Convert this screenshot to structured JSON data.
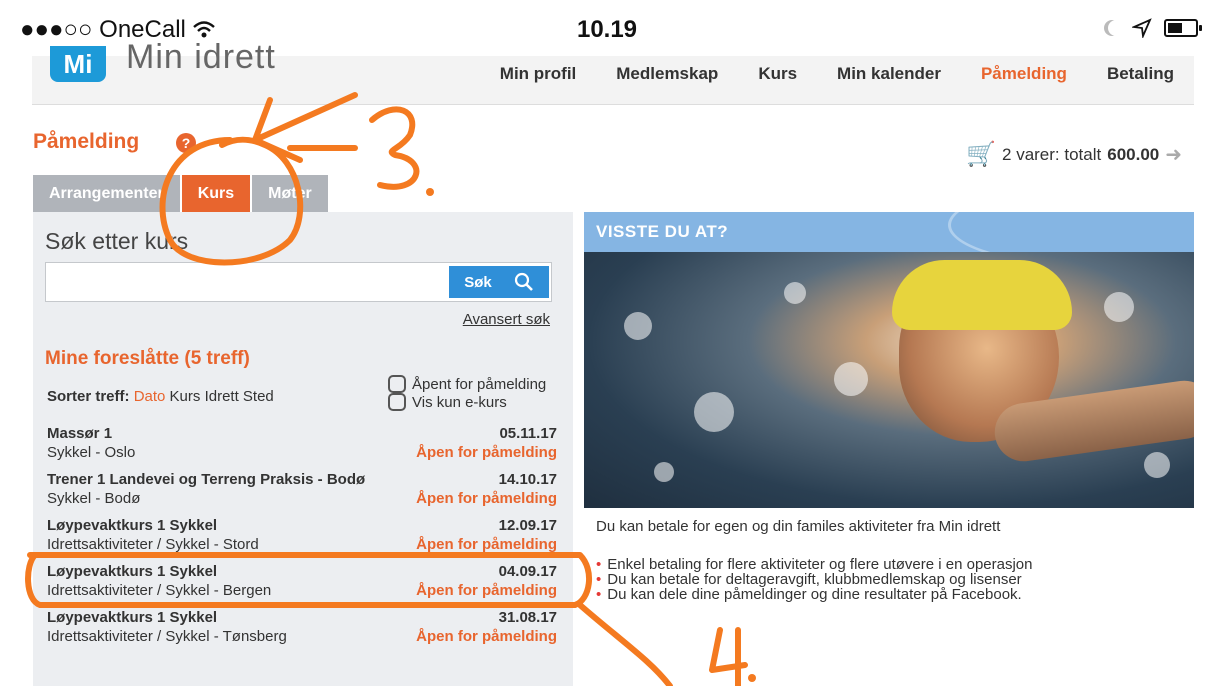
{
  "status_bar": {
    "signal": "●●●○○",
    "carrier": "OneCall",
    "wifi_icon": "wifi-icon",
    "time": "10.19"
  },
  "header": {
    "logo_mark": "Mi",
    "logo_text": "Min idrett",
    "nav": [
      {
        "label": "Min profil",
        "active": false
      },
      {
        "label": "Medlemskap",
        "active": false
      },
      {
        "label": "Kurs",
        "active": false
      },
      {
        "label": "Min kalender",
        "active": false
      },
      {
        "label": "Påmelding",
        "active": true
      },
      {
        "label": "Betaling",
        "active": false
      }
    ]
  },
  "page": {
    "title": "Påmelding",
    "help": "?"
  },
  "cart": {
    "items_text": "2 varer: totalt",
    "total": "600.00"
  },
  "tabs": [
    {
      "label": "Arrangementer",
      "active": false
    },
    {
      "label": "Kurs",
      "active": true
    },
    {
      "label": "Møter",
      "active": false
    }
  ],
  "search": {
    "label": "Søk etter kurs",
    "placeholder": "",
    "button": "Søk",
    "advanced": "Avansert søk"
  },
  "suggestions": {
    "title": "Mine foreslåtte (5 treff)",
    "sort_label": "Sorter treff:",
    "sort_options": [
      "Dato",
      "Kurs",
      "Idrett",
      "Sted"
    ],
    "sort_active": "Dato",
    "filters": [
      "Åpent for påmelding",
      "Vis kun e-kurs"
    ],
    "results": [
      {
        "title": "Massør 1",
        "subtitle": "Sykkel - Oslo",
        "date": "05.11.17",
        "status": "Åpen for påmelding"
      },
      {
        "title": "Trener 1 Landevei og Terreng Praksis - Bodø",
        "subtitle": "Sykkel - Bodø",
        "date": "14.10.17",
        "status": "Åpen for påmelding"
      },
      {
        "title": "Løypevaktkurs 1 Sykkel",
        "subtitle": "Idrettsaktiviteter / Sykkel - Stord",
        "date": "12.09.17",
        "status": "Åpen for påmelding"
      },
      {
        "title": "Løypevaktkurs 1 Sykkel",
        "subtitle": "Idrettsaktiviteter / Sykkel - Bergen",
        "date": "04.09.17",
        "status": "Åpen for påmelding"
      },
      {
        "title": "Løypevaktkurs 1 Sykkel",
        "subtitle": "Idrettsaktiviteter / Sykkel - Tønsberg",
        "date": "31.08.17",
        "status": "Åpen for påmelding"
      }
    ]
  },
  "info": {
    "header": "VISSTE DU AT?",
    "text": "Du kan betale for egen og din familes aktiviteter fra Min idrett",
    "bullets": [
      "Enkel betaling for flere aktiviteter og flere utøvere i en operasjon",
      "Du kan betale for deltageravgift, klubbmedlemskap og lisenser",
      "Du kan dele dine påmeldinger og dine resultater på Facebook."
    ]
  },
  "annotations": {
    "label_3": "3.",
    "label_4": "4.",
    "color": "#f47a20"
  }
}
